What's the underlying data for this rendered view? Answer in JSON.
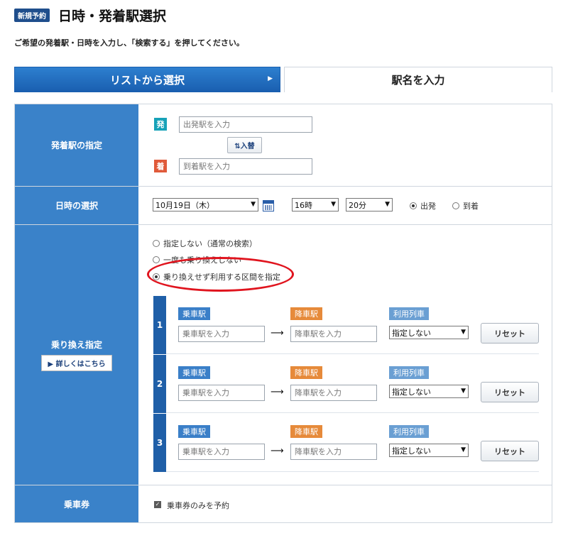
{
  "header": {
    "badge": "新規予約",
    "title": "日時・発着駅選択",
    "instruction": "ご希望の発着駅・日時を入力し、「検索する」を押してください。"
  },
  "tabs": {
    "list_label": "リストから選択",
    "list_arrow": "▶",
    "station_label": "駅名を入力"
  },
  "stations": {
    "label": "発着駅の指定",
    "depart_tag": "発",
    "depart_placeholder": "出発駅を入力",
    "swap_label": "⇅入替",
    "arrive_tag": "着",
    "arrive_placeholder": "到着駅を入力"
  },
  "datetime": {
    "label": "日時の選択",
    "date": "10月19日（木）",
    "hour": "16時",
    "minute": "20分",
    "depart_label": "出発",
    "arrive_label": "到着",
    "selected": "出発"
  },
  "transfer": {
    "label": "乗り換え指定",
    "detail_button": "▶ 詳しくはこちら",
    "options": [
      "指定しない（通常の検索）",
      "一度も乗り換えしない",
      "乗り換えせず利用する区間を指定"
    ],
    "selected_option": "乗り換えせず利用する区間を指定",
    "segments": [
      {
        "num": "1",
        "board_label": "乗車駅",
        "board_placeholder": "乗車駅を入力",
        "alight_label": "降車駅",
        "alight_placeholder": "降車駅を入力",
        "train_label": "利用列車",
        "train_value": "指定しない",
        "reset_label": "リセット"
      },
      {
        "num": "2",
        "board_label": "乗車駅",
        "board_placeholder": "乗車駅を入力",
        "alight_label": "降車駅",
        "alight_placeholder": "降車駅を入力",
        "train_label": "利用列車",
        "train_value": "指定しない",
        "reset_label": "リセット"
      },
      {
        "num": "3",
        "board_label": "乗車駅",
        "board_placeholder": "乗車駅を入力",
        "alight_label": "降車駅",
        "alight_placeholder": "降車駅を入力",
        "train_label": "利用列車",
        "train_value": "指定しない",
        "reset_label": "リセット"
      }
    ]
  },
  "ticket": {
    "label": "乗車券",
    "checkbox_label": "乗車券のみを予約",
    "checked": true
  },
  "colors": {
    "header_blue": "#3a82c9",
    "tab_blue": "#1a5fb0",
    "depart_tag": "#17a2b8",
    "arrive_tag": "#e05a3a",
    "annotation_red": "#e0141e"
  }
}
